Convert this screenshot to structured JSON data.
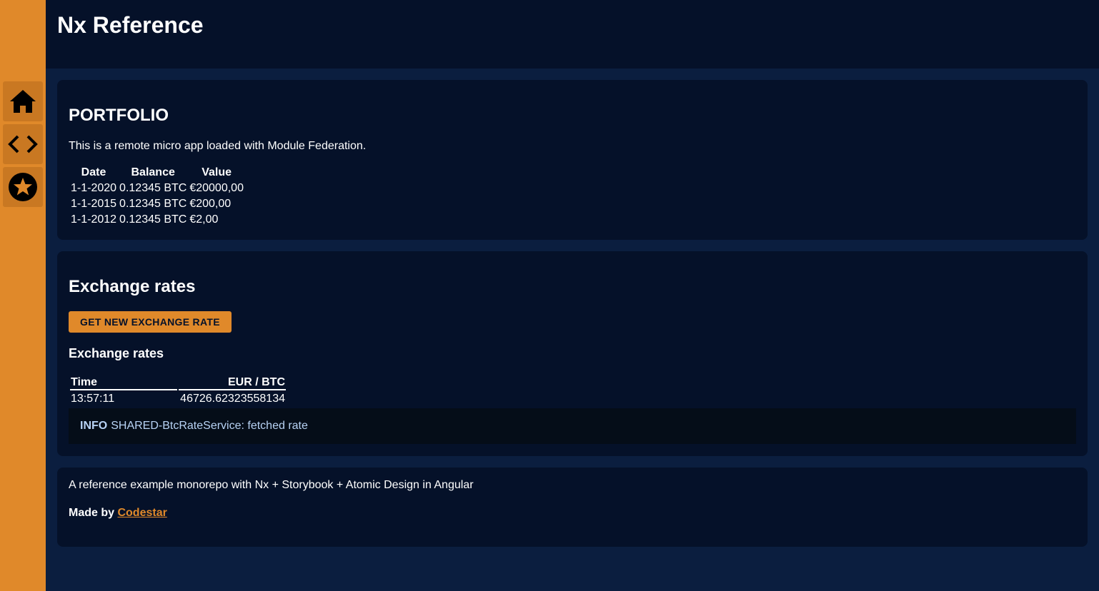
{
  "app": {
    "title": "Nx Reference"
  },
  "sidebar": {
    "items": [
      {
        "icon": "home-icon"
      },
      {
        "icon": "code-icon"
      },
      {
        "icon": "star-icon"
      }
    ]
  },
  "portfolio": {
    "title": "PORTFOLIO",
    "description": "This is a remote micro app loaded with Module Federation.",
    "columns": [
      "Date",
      "Balance",
      "Value"
    ],
    "rows": [
      [
        "1-1-2020",
        "0.12345 BTC",
        "€20000,00"
      ],
      [
        "1-1-2015",
        "0.12345 BTC",
        "€200,00"
      ],
      [
        "1-1-2012",
        "0.12345 BTC",
        "€2,00"
      ]
    ]
  },
  "exchange": {
    "title": "Exchange rates",
    "button_label": "GET NEW EXCHANGE RATE",
    "subtitle": "Exchange rates",
    "columns": [
      "Time",
      "EUR / BTC"
    ],
    "rows": [
      [
        "13:57:11",
        "46726.62323558134"
      ]
    ],
    "log": {
      "level": "INFO",
      "message": "SHARED-BtcRateService: fetched rate"
    }
  },
  "footer": {
    "description": "A reference example monorepo with Nx + Storybook + Atomic Design in Angular",
    "made_by_label": "Made by",
    "made_by_link": "Codestar"
  },
  "colors": {
    "accent": "#e0892a",
    "header_bg": "#051129",
    "page_bg": "#0b1e3f",
    "log_text": "#b8d3f5"
  }
}
